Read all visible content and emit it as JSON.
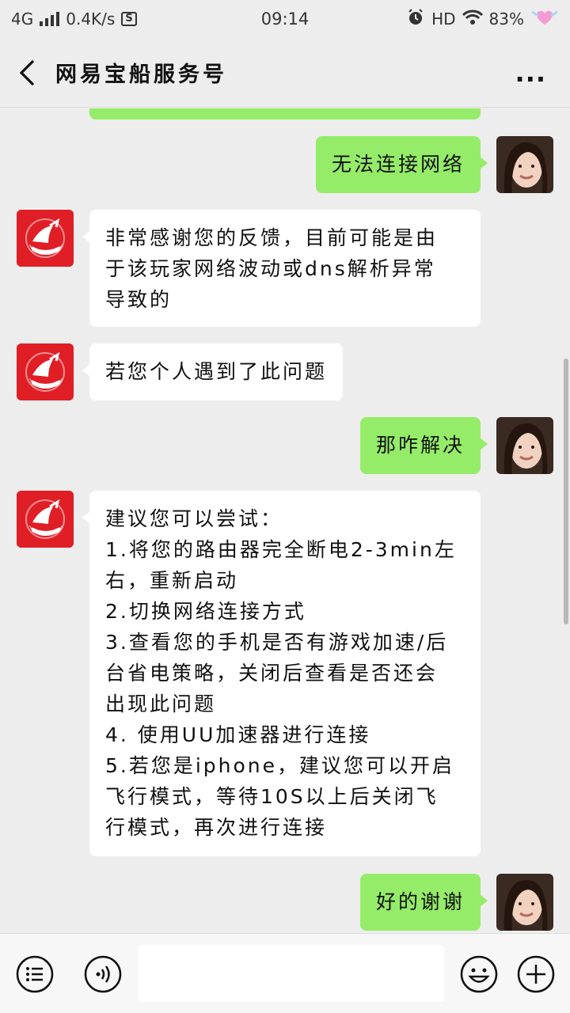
{
  "status_bar": {
    "network": "4G",
    "speed": "0.4K/s",
    "sim_icon": "S",
    "time": "09:14",
    "hd": "HD",
    "battery": "83%",
    "icons": [
      "signal-icon",
      "sim-icon",
      "alarm-icon",
      "wifi-icon",
      "heart-battery-icon"
    ]
  },
  "header": {
    "title": "网易宝船服务号",
    "back_icon": "chevron-left-icon",
    "more_label": "..."
  },
  "messages": [
    {
      "sender": "me",
      "lines": [
        "无法连接网络"
      ]
    },
    {
      "sender": "official",
      "lines": [
        "非常感谢您的反馈，目前可能是由",
        "于该玩家网络波动或dns解析异常",
        "导致的"
      ]
    },
    {
      "sender": "official",
      "lines": [
        "若您个人遇到了此问题"
      ]
    },
    {
      "sender": "me",
      "lines": [
        "那咋解决"
      ]
    },
    {
      "sender": "official",
      "lines": [
        "建议您可以尝试：",
        "1.将您的路由器完全断电2-3min左",
        "右，重新启动",
        "2.切换网络连接方式",
        "3.查看您的手机是否有游戏加速/后",
        "台省电策略，关闭后查看是否还会",
        "出现此问题",
        "4. 使用UU加速器进行连接",
        "5.若您是iphone，建议您可以开启",
        "飞行模式，等待10S以上后关闭飞",
        "行模式，再次进行连接"
      ]
    },
    {
      "sender": "me",
      "lines": [
        "好的谢谢"
      ]
    }
  ],
  "input_bar": {
    "menu_icon": "list-menu-icon",
    "voice_icon": "voice-icon",
    "input_value": "",
    "emoji_icon": "emoji-icon",
    "plus_icon": "plus-icon"
  },
  "colors": {
    "outgoing_bubble": "#95ec69",
    "incoming_bubble": "#ffffff",
    "background": "#ededed",
    "official_avatar": "#e01e26"
  }
}
